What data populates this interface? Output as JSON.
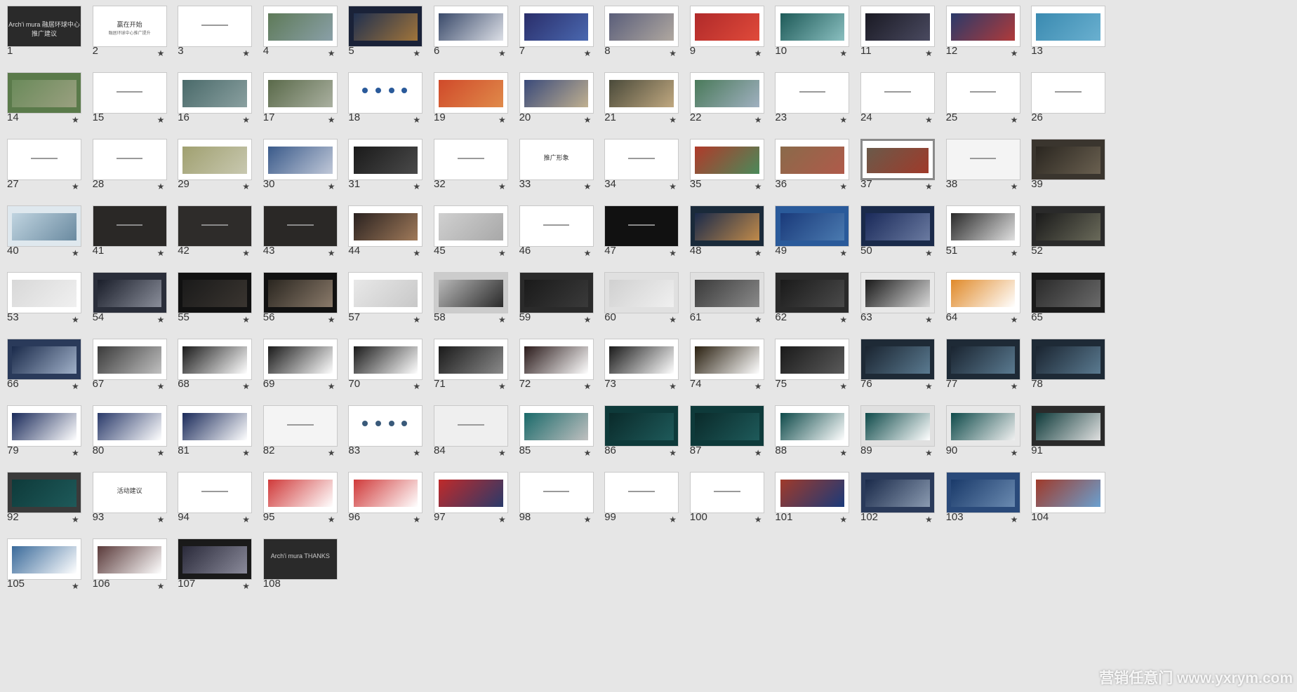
{
  "watermark": "营销任意门 www.yxrym.com",
  "star_glyph": "★",
  "selected": 37,
  "slides": [
    {
      "n": "1",
      "bg": "#2a2a2a",
      "text": "Arch'i mura 融居环球中心推广建议",
      "fg": "#dddddd",
      "star": false
    },
    {
      "n": "2",
      "bg": "#ffffff",
      "text": "赢在开始",
      "sub": "融居环球中心推广提升",
      "fg": "#333333",
      "star": true
    },
    {
      "n": "3",
      "bg": "#ffffff",
      "line": true,
      "star": true
    },
    {
      "n": "4",
      "bg": "#ffffff",
      "img": [
        "#5e7a58",
        "#8aa0a8"
      ],
      "side": "#ffffff",
      "star": true
    },
    {
      "n": "5",
      "bg": "#1a2238",
      "img": [
        "#20304f",
        "#a0743a"
      ],
      "star": true
    },
    {
      "n": "6",
      "bg": "#ffffff",
      "img": [
        "#3a4a6a",
        "#dcdfe6"
      ],
      "star": true
    },
    {
      "n": "7",
      "bg": "#ffffff",
      "img": [
        "#2a2e6a",
        "#4a68b0"
      ],
      "star": true
    },
    {
      "n": "8",
      "bg": "#ffffff",
      "img": [
        "#5a5e7a",
        "#b0a8a0"
      ],
      "star": true
    },
    {
      "n": "9",
      "bg": "#ffffff",
      "img": [
        "#b02a2a",
        "#e04a3a"
      ],
      "star": true
    },
    {
      "n": "10",
      "bg": "#ffffff",
      "img": [
        "#1e5a58",
        "#8abfc0"
      ],
      "star": true
    },
    {
      "n": "11",
      "bg": "#ffffff",
      "img": [
        "#1a1a24",
        "#4a4a60"
      ],
      "star": true
    },
    {
      "n": "12",
      "bg": "#ffffff",
      "img": [
        "#2a3a6a",
        "#b03a3a"
      ],
      "star": true
    },
    {
      "n": "13",
      "bg": "#ffffff",
      "img": [
        "#3a8ab0",
        "#6ab0d0"
      ],
      "star": false
    },
    {
      "n": "14",
      "bg": "#5a7a4a",
      "img": [
        "#6a8a5a",
        "#9aa080"
      ],
      "star": true
    },
    {
      "n": "15",
      "bg": "#ffffff",
      "line": true,
      "star": true
    },
    {
      "n": "16",
      "bg": "#ffffff",
      "img": [
        "#4a6a6a",
        "#8aa0a0"
      ],
      "star": true
    },
    {
      "n": "17",
      "bg": "#ffffff",
      "img": [
        "#5a6a4a",
        "#aab0a0"
      ],
      "star": true
    },
    {
      "n": "18",
      "bg": "#ffffff",
      "dots": "#2a5a9a",
      "star": true
    },
    {
      "n": "19",
      "bg": "#ffffff",
      "img": [
        "#d04a2a",
        "#e08a4a"
      ],
      "star": true
    },
    {
      "n": "20",
      "bg": "#ffffff",
      "img": [
        "#3a4a7a",
        "#c0b090"
      ],
      "star": true
    },
    {
      "n": "21",
      "bg": "#ffffff",
      "img": [
        "#4a4a3a",
        "#c0a880"
      ],
      "star": true
    },
    {
      "n": "22",
      "bg": "#ffffff",
      "img": [
        "#4a7a5a",
        "#a0b0c0"
      ],
      "star": true
    },
    {
      "n": "23",
      "bg": "#ffffff",
      "line": true,
      "star": true
    },
    {
      "n": "24",
      "bg": "#ffffff",
      "line": true,
      "star": true
    },
    {
      "n": "25",
      "bg": "#ffffff",
      "line": true,
      "star": true
    },
    {
      "n": "26",
      "bg": "#ffffff",
      "line": true,
      "star": false
    },
    {
      "n": "27",
      "bg": "#ffffff",
      "line": true,
      "star": true
    },
    {
      "n": "28",
      "bg": "#ffffff",
      "line": true,
      "star": true
    },
    {
      "n": "29",
      "bg": "#ffffff",
      "img": [
        "#a0a070",
        "#c8c8b0"
      ],
      "star": true
    },
    {
      "n": "30",
      "bg": "#ffffff",
      "img": [
        "#3a5a8a",
        "#c0c8d8"
      ],
      "star": true
    },
    {
      "n": "31",
      "bg": "#ffffff",
      "img": [
        "#1a1a1a",
        "#4a4a4a"
      ],
      "star": true
    },
    {
      "n": "32",
      "bg": "#ffffff",
      "line": true,
      "star": true
    },
    {
      "n": "33",
      "bg": "#ffffff",
      "text": "推广形象",
      "fg": "#333333",
      "star": true
    },
    {
      "n": "34",
      "bg": "#ffffff",
      "line": true,
      "star": true
    },
    {
      "n": "35",
      "bg": "#ffffff",
      "img": [
        "#b03a2a",
        "#4a8a5a"
      ],
      "star": true
    },
    {
      "n": "36",
      "bg": "#ffffff",
      "img": [
        "#8a6a4a",
        "#b05a4a"
      ],
      "star": true
    },
    {
      "n": "37",
      "bg": "#ffffff",
      "img": [
        "#6a5a4a",
        "#a03a2a"
      ],
      "star": true
    },
    {
      "n": "38",
      "bg": "#f4f4f4",
      "line": true,
      "star": true
    },
    {
      "n": "39",
      "bg": "#3a352e",
      "img": [
        "#2a2620",
        "#6a6050"
      ],
      "star": false
    },
    {
      "n": "40",
      "bg": "#dfe8ee",
      "img": [
        "#c0d4e0",
        "#6a8aa0"
      ],
      "star": true
    },
    {
      "n": "41",
      "bg": "#2a2826",
      "line": true,
      "star": true
    },
    {
      "n": "42",
      "bg": "#2e2c2a",
      "line": true,
      "star": true
    },
    {
      "n": "43",
      "bg": "#2a2826",
      "line": true,
      "star": true
    },
    {
      "n": "44",
      "bg": "#ffffff",
      "img": [
        "#2a2220",
        "#a07a5a"
      ],
      "star": true
    },
    {
      "n": "45",
      "bg": "#ffffff",
      "img": [
        "#d0d0d0",
        "#a8a8a8"
      ],
      "star": true
    },
    {
      "n": "46",
      "bg": "#ffffff",
      "line": true,
      "star": true
    },
    {
      "n": "47",
      "bg": "#111111",
      "line": true,
      "star": true
    },
    {
      "n": "48",
      "bg": "#1a2a3a",
      "img": [
        "#1a2a4a",
        "#c08a4a"
      ],
      "star": true
    },
    {
      "n": "49",
      "bg": "#2a5a9a",
      "img": [
        "#1a3a7a",
        "#4a7ab0"
      ],
      "star": true
    },
    {
      "n": "50",
      "bg": "#1a2a4a",
      "img": [
        "#1a2a5a",
        "#6a7aa0"
      ],
      "star": true
    },
    {
      "n": "51",
      "bg": "#ffffff",
      "img": [
        "#2a2a2a",
        "#e0e0e0"
      ],
      "star": true
    },
    {
      "n": "52",
      "bg": "#2a2a2a",
      "img": [
        "#1a1a1a",
        "#6a6a5a"
      ],
      "star": false
    },
    {
      "n": "53",
      "bg": "#ffffff",
      "img": [
        "#d8d8d8",
        "#f0f0f0"
      ],
      "star": true
    },
    {
      "n": "54",
      "bg": "#2a2e3a",
      "img": [
        "#1a1e2a",
        "#8a8e9a"
      ],
      "star": true
    },
    {
      "n": "55",
      "bg": "#111111",
      "img": [
        "#1a1a1a",
        "#3a3530"
      ],
      "star": true
    },
    {
      "n": "56",
      "bg": "#111111",
      "img": [
        "#2a2620",
        "#8a7a6a"
      ],
      "star": true
    },
    {
      "n": "57",
      "bg": "#ffffff",
      "img": [
        "#e8e8e8",
        "#c8c8c8"
      ],
      "star": true
    },
    {
      "n": "58",
      "bg": "#cccccc",
      "img": [
        "#b8b8b8",
        "#2a2a2a"
      ],
      "star": true
    },
    {
      "n": "59",
      "bg": "#2a2a2a",
      "img": [
        "#1a1a1a",
        "#3a3a3a"
      ],
      "star": true
    },
    {
      "n": "60",
      "bg": "#e0e0e0",
      "img": [
        "#d0d0d0",
        "#f0f0f0"
      ],
      "star": true
    },
    {
      "n": "61",
      "bg": "#e0e0e0",
      "img": [
        "#3a3a3a",
        "#8a8a8a"
      ],
      "star": true
    },
    {
      "n": "62",
      "bg": "#2a2a2a",
      "img": [
        "#1a1a1a",
        "#4a4a4a"
      ],
      "star": true
    },
    {
      "n": "63",
      "bg": "#e8e8e8",
      "img": [
        "#1a1a1a",
        "#d8d8d8"
      ],
      "star": true
    },
    {
      "n": "64",
      "bg": "#ffffff",
      "img": [
        "#e08a2a",
        "#ffffff"
      ],
      "star": true
    },
    {
      "n": "65",
      "bg": "#1a1a1a",
      "img": [
        "#2a2a2a",
        "#6a6a6a"
      ],
      "star": false
    },
    {
      "n": "66",
      "bg": "#2a3a5a",
      "img": [
        "#1a2a4a",
        "#a0b0c8"
      ],
      "star": true
    },
    {
      "n": "67",
      "bg": "#ffffff",
      "img": [
        "#3a3a3a",
        "#c0c0c0"
      ],
      "star": true
    },
    {
      "n": "68",
      "bg": "#ffffff",
      "img": [
        "#1a1a1a",
        "#ffffff"
      ],
      "star": true
    },
    {
      "n": "69",
      "bg": "#ffffff",
      "img": [
        "#1a1a1a",
        "#ffffff"
      ],
      "star": true
    },
    {
      "n": "70",
      "bg": "#ffffff",
      "img": [
        "#1a1a1a",
        "#ffffff"
      ],
      "star": true
    },
    {
      "n": "71",
      "bg": "#ffffff",
      "img": [
        "#1a1a1a",
        "#8a8a8a"
      ],
      "star": true
    },
    {
      "n": "72",
      "bg": "#ffffff",
      "img": [
        "#2a1a1a",
        "#ffffff"
      ],
      "star": true
    },
    {
      "n": "73",
      "bg": "#ffffff",
      "img": [
        "#1a1a1a",
        "#ffffff"
      ],
      "star": true
    },
    {
      "n": "74",
      "bg": "#ffffff",
      "img": [
        "#2a2010",
        "#ffffff"
      ],
      "star": true
    },
    {
      "n": "75",
      "bg": "#ffffff",
      "img": [
        "#1a1a1a",
        "#5a5a5a"
      ],
      "star": true
    },
    {
      "n": "76",
      "bg": "#1e2a36",
      "img": [
        "#1a2430",
        "#5a7a90"
      ],
      "star": true
    },
    {
      "n": "77",
      "bg": "#1e2a36",
      "img": [
        "#1a2430",
        "#5a7a90"
      ],
      "star": true
    },
    {
      "n": "78",
      "bg": "#1e2a36",
      "img": [
        "#1a2430",
        "#5a7a90"
      ],
      "star": false
    },
    {
      "n": "79",
      "bg": "#ffffff",
      "img": [
        "#1a2a5a",
        "#ffffff"
      ],
      "star": true
    },
    {
      "n": "80",
      "bg": "#ffffff",
      "img": [
        "#2a3a6a",
        "#ffffff"
      ],
      "star": true
    },
    {
      "n": "81",
      "bg": "#ffffff",
      "img": [
        "#1a2a5a",
        "#ffffff"
      ],
      "star": true
    },
    {
      "n": "82",
      "bg": "#f4f4f4",
      "line": true,
      "star": true
    },
    {
      "n": "83",
      "bg": "#ffffff",
      "dots": "#3a5a7a",
      "star": true
    },
    {
      "n": "84",
      "bg": "#efefef",
      "line": true,
      "star": true
    },
    {
      "n": "85",
      "bg": "#ffffff",
      "img": [
        "#1a6a6a",
        "#c0c0c0"
      ],
      "star": true
    },
    {
      "n": "86",
      "bg": "#0e3a3a",
      "img": [
        "#0a2a2a",
        "#1e5a5a"
      ],
      "star": true
    },
    {
      "n": "87",
      "bg": "#0e3a3a",
      "img": [
        "#0a2a2a",
        "#1e5a5a"
      ],
      "star": true
    },
    {
      "n": "88",
      "bg": "#ffffff",
      "img": [
        "#0e4a4a",
        "#ffffff"
      ],
      "star": true
    },
    {
      "n": "89",
      "bg": "#e0e0e0",
      "img": [
        "#0e4a4a",
        "#ffffff"
      ],
      "star": true
    },
    {
      "n": "90",
      "bg": "#e8e8e8",
      "img": [
        "#0e4a4a",
        "#f0f0f0"
      ],
      "star": true
    },
    {
      "n": "91",
      "bg": "#2a2a2a",
      "img": [
        "#0e3a3a",
        "#e0e0e0"
      ],
      "star": false
    },
    {
      "n": "92",
      "bg": "#3a3a3a",
      "img": [
        "#0e3a3a",
        "#1e5a5a"
      ],
      "star": true
    },
    {
      "n": "93",
      "bg": "#ffffff",
      "text": "活动建议",
      "fg": "#333333",
      "star": true
    },
    {
      "n": "94",
      "bg": "#ffffff",
      "line": true,
      "star": true
    },
    {
      "n": "95",
      "bg": "#ffffff",
      "img": [
        "#d03a3a",
        "#ffffff"
      ],
      "star": true
    },
    {
      "n": "96",
      "bg": "#ffffff",
      "img": [
        "#d03a3a",
        "#ffffff"
      ],
      "star": true
    },
    {
      "n": "97",
      "bg": "#ffffff",
      "img": [
        "#c02a2a",
        "#2a3a6a"
      ],
      "star": true
    },
    {
      "n": "98",
      "bg": "#ffffff",
      "line": true,
      "star": true
    },
    {
      "n": "99",
      "bg": "#ffffff",
      "line": true,
      "star": true
    },
    {
      "n": "100",
      "bg": "#ffffff",
      "line": true,
      "star": true
    },
    {
      "n": "101",
      "bg": "#ffffff",
      "img": [
        "#a03a2a",
        "#1a3a7a"
      ],
      "star": true
    },
    {
      "n": "102",
      "bg": "#2a3a5a",
      "img": [
        "#1a2a4a",
        "#8a9ab0"
      ],
      "star": true
    },
    {
      "n": "103",
      "bg": "#2a4a7a",
      "img": [
        "#1a3a6a",
        "#6a8ab0"
      ],
      "star": true
    },
    {
      "n": "104",
      "bg": "#ffffff",
      "img": [
        "#a03a2a",
        "#6aa0d0"
      ],
      "star": false
    },
    {
      "n": "105",
      "bg": "#ffffff",
      "img": [
        "#3a6a9a",
        "#ffffff"
      ],
      "star": true
    },
    {
      "n": "106",
      "bg": "#ffffff",
      "img": [
        "#5a3a3a",
        "#ffffff"
      ],
      "star": true
    },
    {
      "n": "107",
      "bg": "#1a1a1a",
      "img": [
        "#2a2a3a",
        "#8a8a9a"
      ],
      "star": true
    },
    {
      "n": "108",
      "bg": "#2a2a2a",
      "text": "Arch'i mura THANKS",
      "fg": "#cccccc",
      "star": false
    }
  ]
}
